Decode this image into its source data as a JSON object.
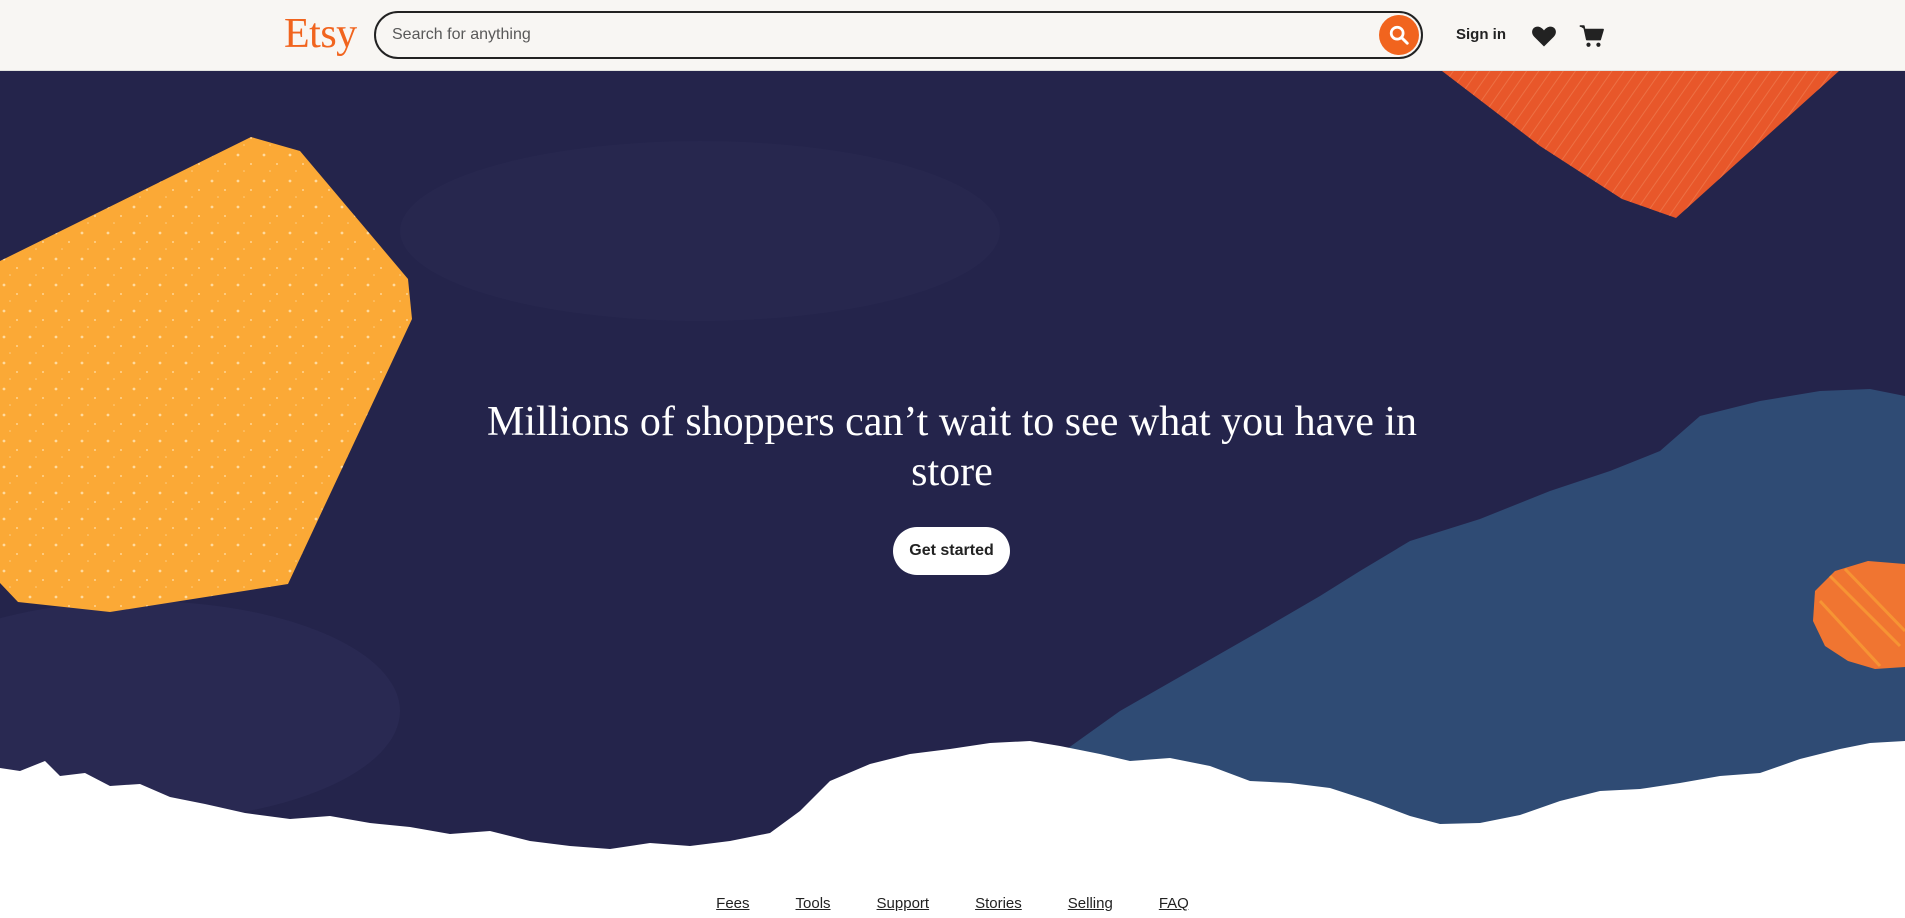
{
  "header": {
    "logo": "Etsy",
    "search": {
      "placeholder": "Search for anything",
      "value": ""
    },
    "sign_in": "Sign in"
  },
  "hero": {
    "headline": "Millions of shoppers can’t wait to see what you have in store",
    "cta": "Get started"
  },
  "footer": {
    "links": [
      "Fees",
      "Tools",
      "Support",
      "Stories",
      "Selling",
      "FAQ"
    ]
  },
  "colors": {
    "brand_orange": "#f1641e",
    "hero_navy": "#24244b",
    "slate_blue": "#2f4b74",
    "mustard": "#fba936",
    "red_orange": "#e8572a"
  },
  "icons": [
    "search-icon",
    "heart-icon",
    "cart-icon"
  ]
}
